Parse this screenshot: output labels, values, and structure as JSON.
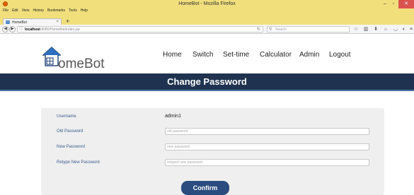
{
  "browser": {
    "window_title": "HomeBot - Mozilla Firefox",
    "menus": [
      "File",
      "Edit",
      "View",
      "History",
      "Bookmarks",
      "Tools",
      "Help"
    ],
    "tab_title": "HomeBot",
    "url_host": "localhost",
    "url_path": ":8080/HomeBot/index.jsp",
    "search_placeholder": "Search"
  },
  "site": {
    "logo_text": "omeBot",
    "nav": [
      "Home",
      "Switch",
      "Set-time",
      "Calculator",
      "Admin",
      "Logout"
    ]
  },
  "page": {
    "title": "Change Password"
  },
  "form": {
    "username_label": "Username",
    "username_value": "admin1",
    "old_label": "Old Password",
    "old_placeholder": "old password",
    "new_label": "New Password",
    "new_placeholder": "new password",
    "retype_label": "Retype New Password",
    "retype_placeholder": "retyped new password",
    "confirm_label": "Confirm"
  },
  "colors": {
    "banner": "#1f3350",
    "accent": "#2b4c7e",
    "label": "#3c5c8c",
    "titlebar": "#f1df7c"
  }
}
